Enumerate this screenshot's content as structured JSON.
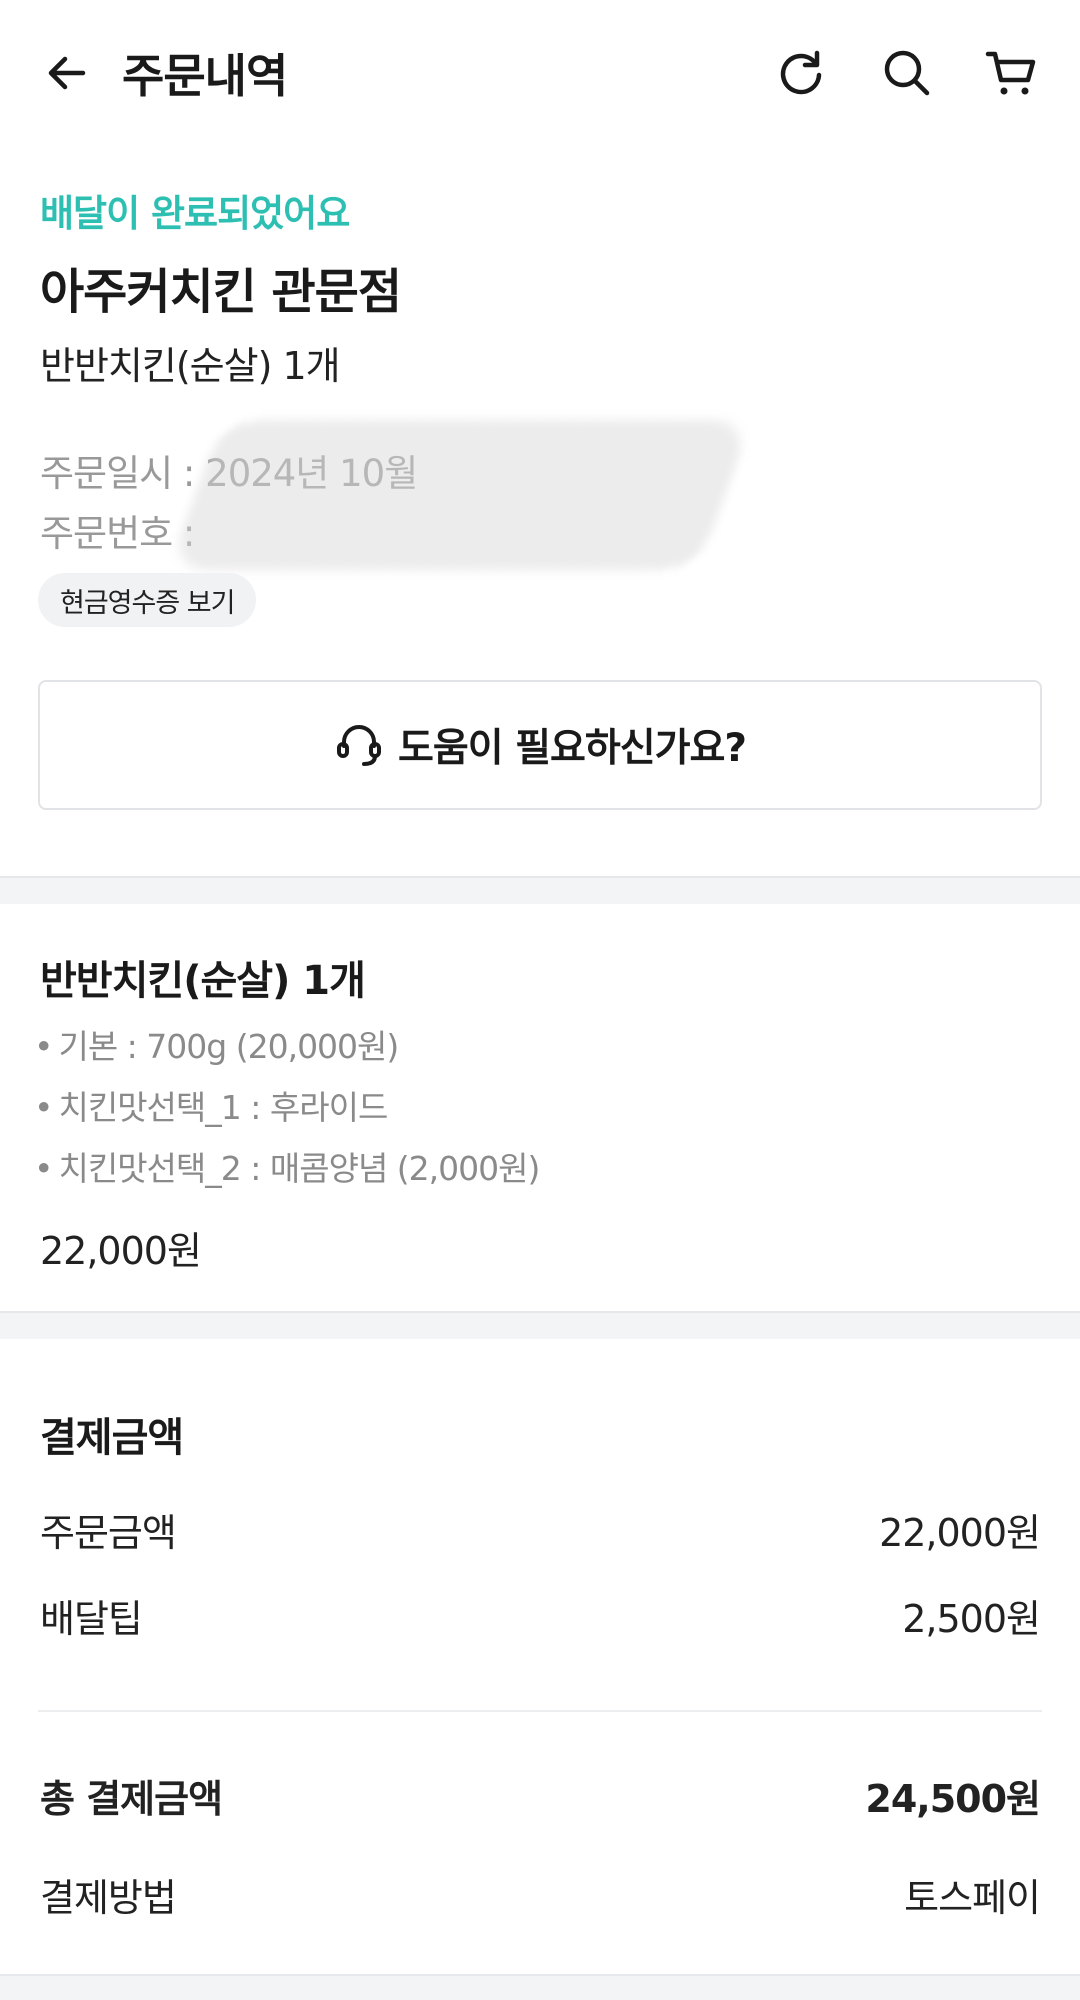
{
  "header": {
    "title": "주문내역",
    "icons": [
      "arrow-left-icon",
      "refresh-icon",
      "search-icon",
      "cart-icon"
    ]
  },
  "order": {
    "status": "배달이 완료되었어요",
    "store_name": "아주커치킨 관문점",
    "menu_summary": "반반치킨(순살) 1개",
    "date_label": "주문일시 : 2024년 10월",
    "number_label": "주문번호 :",
    "receipt_button": "현금영수증 보기",
    "help_button": "도움이 필요하신가요?"
  },
  "item": {
    "title": "반반치킨(순살) 1개",
    "options": [
      "기본 : 700g (20,000원)",
      "치킨맛선택_1 : 후라이드",
      "치킨맛선택_2 : 매콤양념 (2,000원)"
    ],
    "price": "22,000원"
  },
  "payment": {
    "title": "결제금액",
    "order_amount_label": "주문금액",
    "order_amount": "22,000원",
    "delivery_tip_label": "배달팁",
    "delivery_tip": "2,500원",
    "total_label": "총 결제금액",
    "total": "24,500원",
    "method_label": "결제방법",
    "method": "토스페이"
  },
  "colors": {
    "status_accent": "#2ebfb3",
    "divider_band": "#f3f4f6",
    "muted_text": "#999999"
  }
}
